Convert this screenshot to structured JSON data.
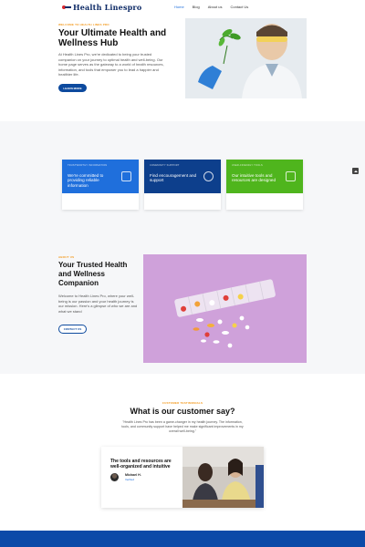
{
  "header": {
    "logo_text": "Health Linespro",
    "nav": [
      "Home",
      "Blog",
      "About us",
      "Contact Us"
    ],
    "active_nav": "Home"
  },
  "hero": {
    "kicker": "WELCOME TO HEALTH LINES PRO",
    "title": "Your Ultimate Health and Wellness Hub",
    "body": "At Health Lines Pro, we're dedicated to being your trusted companion on your journey to optimal health and well-being. Our home page serves as the gateway to a world of health resources, information, and tools that empower you to lead a happier and healthier life.",
    "button": "LEARN MORE"
  },
  "features": [
    {
      "tag": "TRUSTWORTHY INFORMATION",
      "title": "We're committed to providing reliable information",
      "color": "#1f6fdc",
      "icon": "book-icon"
    },
    {
      "tag": "COMMUNITY SUPPORT",
      "title": "Find encouragement and support",
      "color": "#0d3f8c",
      "icon": "person-icon"
    },
    {
      "tag": "USER-FRIENDLY TOOLS",
      "title": "Our intuitive tools and resources are designed",
      "color": "#4fb51d",
      "icon": "lock-icon"
    }
  ],
  "about": {
    "kicker": "ABOUT US",
    "title": "Your Trusted Health and Wellness Companion",
    "body": "Welcome to Health Lines Pro, where your well-being is our passion and your health journey is our mission. Here's a glimpse of who we are and what we stand",
    "button": "CONTACT US"
  },
  "testimonials": {
    "kicker": "CUSTOMER TESTIMONIALS",
    "title": "What is our customer say?",
    "quote": "\"Health Lines Pro has been a game-changer in my health journey. The information, tools, and community support have helped me make significant improvements in my overall well-being.\"",
    "card_headline": "The tools and resources are well-organized and intuitive",
    "name": "Michael H.",
    "role": "Verified"
  },
  "colors": {
    "brand_blue": "#0d4a9e",
    "accent_orange": "#f39a1e",
    "link_blue": "#1f6fdc",
    "green": "#4fb51d",
    "footer_blue": "#0c4aa8"
  }
}
